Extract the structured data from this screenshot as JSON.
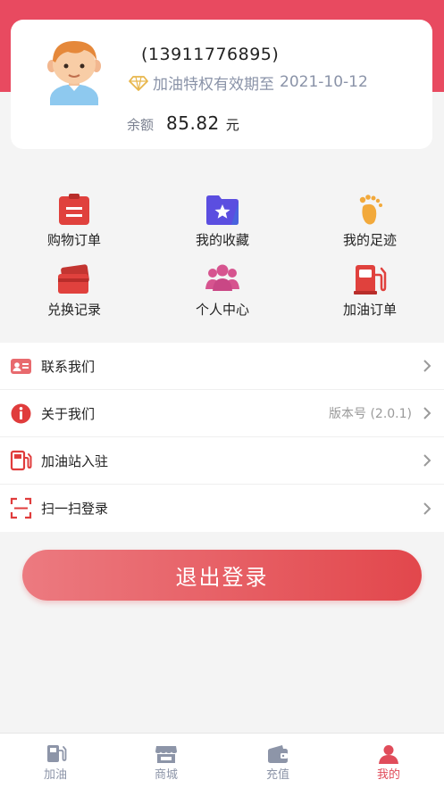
{
  "profile": {
    "phone": "(13911776895)",
    "vip_text": "加油特权有效期至",
    "vip_date": "2021-10-12",
    "balance_label": "余额",
    "balance_value": "85.82",
    "balance_unit": "元"
  },
  "grid": [
    {
      "label": "购物订单",
      "icon": "order-clipboard-icon",
      "color": "#e0413d"
    },
    {
      "label": "我的收藏",
      "icon": "star-folder-icon",
      "color": "#5b4ee0"
    },
    {
      "label": "我的足迹",
      "icon": "footprint-icon",
      "color": "#f2a93b"
    },
    {
      "label": "兑换记录",
      "icon": "exchange-cards-icon",
      "color": "#e0413d"
    },
    {
      "label": "个人中心",
      "icon": "people-group-icon",
      "color": "#d6548f"
    },
    {
      "label": "加油订单",
      "icon": "fuel-pump-icon",
      "color": "#e0413d"
    }
  ],
  "menu": [
    {
      "label": "联系我们",
      "extra": "",
      "icon": "contact-card-icon"
    },
    {
      "label": "关于我们",
      "extra": "版本号 (2.0.1)",
      "icon": "info-icon"
    },
    {
      "label": "加油站入驻",
      "extra": "",
      "icon": "fuel-pump-icon"
    },
    {
      "label": "扫一扫登录",
      "extra": "",
      "icon": "scan-icon"
    }
  ],
  "logout_label": "退出登录",
  "tabs": [
    {
      "label": "加油",
      "icon": "fuel-pump-icon",
      "active": false
    },
    {
      "label": "商城",
      "icon": "shop-icon",
      "active": false
    },
    {
      "label": "充值",
      "icon": "wallet-icon",
      "active": false
    },
    {
      "label": "我的",
      "icon": "user-icon",
      "active": true
    }
  ],
  "colors": {
    "brand": "#e84a60",
    "accent_red": "#e2474c",
    "muted": "#8a93a8"
  }
}
